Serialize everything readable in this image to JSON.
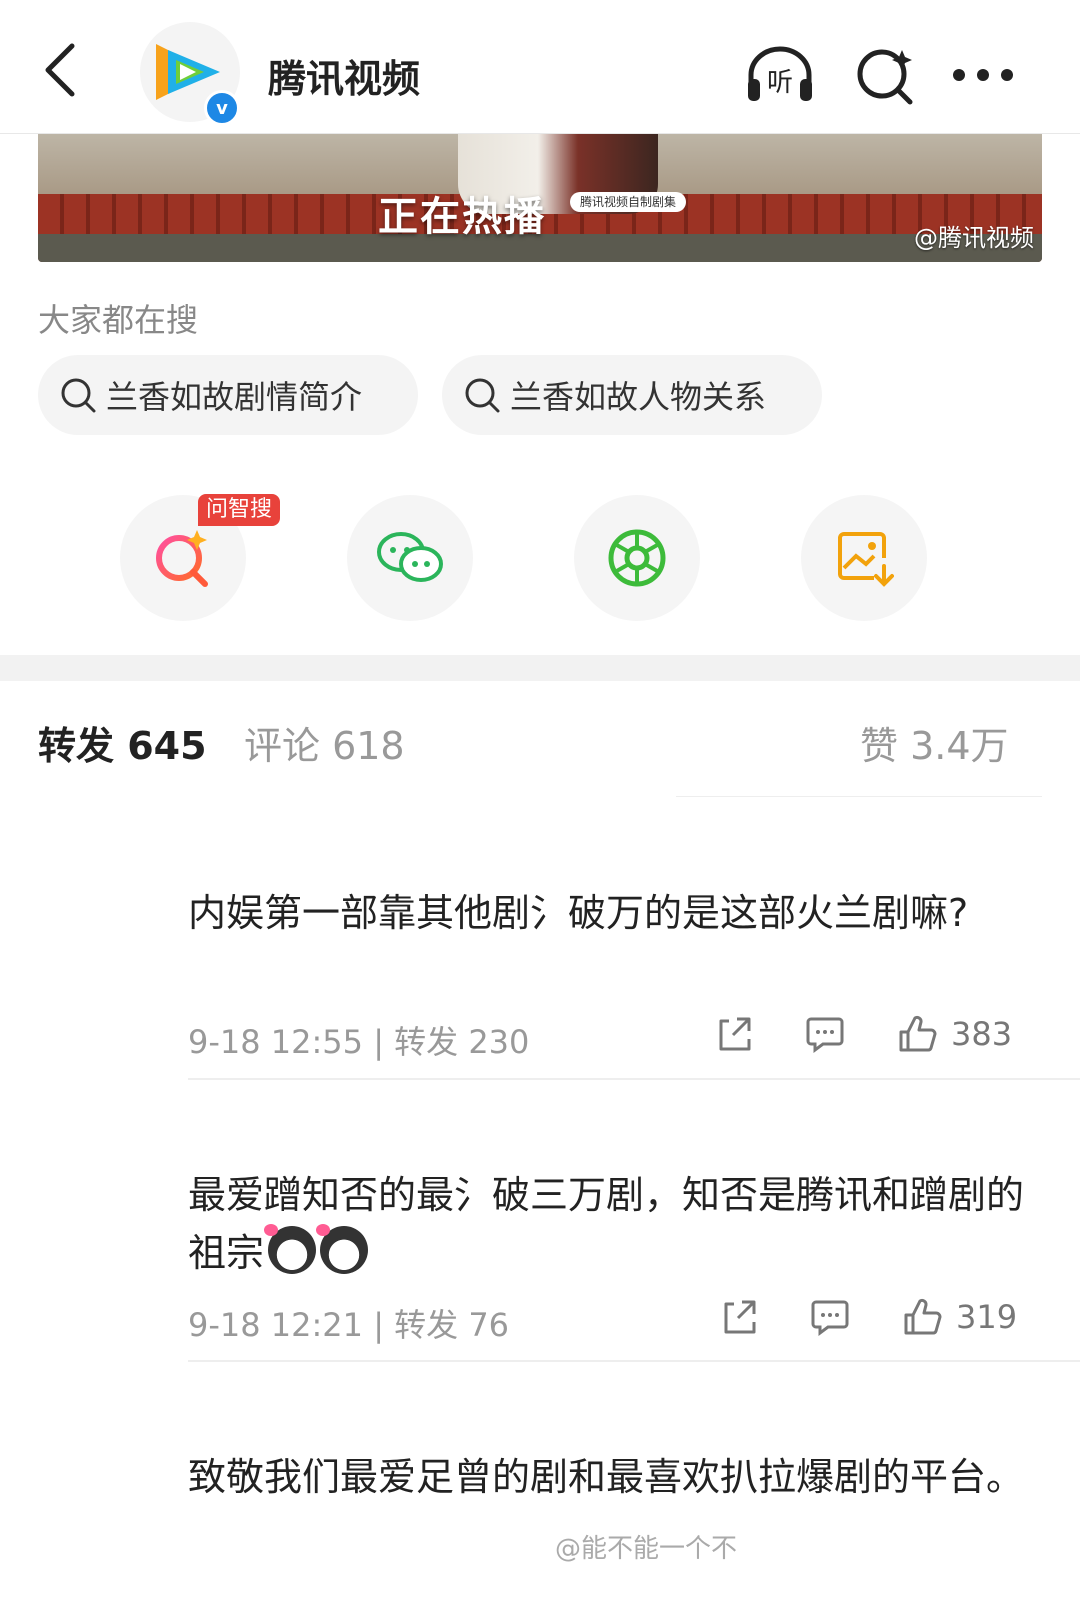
{
  "header": {
    "title": "腾讯视频",
    "back_icon": "chevron-left-icon",
    "listen_icon": "headphones-icon",
    "search_icon": "search-icon",
    "more_icon": "more-icon",
    "listen_label": "听"
  },
  "banner": {
    "headline": "正在热播",
    "tag": "腾讯视频自制剧集",
    "watermark": "@腾讯视频"
  },
  "search_section": {
    "label": "大家都在搜",
    "chips": [
      "兰香如故剧情简介",
      "兰香如故人物关系"
    ]
  },
  "share_actions": {
    "badge": "问智搜",
    "items": [
      "ai-search-icon",
      "wechat-icon",
      "moments-icon",
      "save-image-icon"
    ]
  },
  "tabs": {
    "repost": "转发 645",
    "comment": "评论 618",
    "like": "赞 3.4万"
  },
  "comments": [
    {
      "text": "内娱第一部靠其他剧氵破万的是这部火兰剧嘛?",
      "meta": "9-18 12:55 | 转发 230",
      "likes": "383"
    },
    {
      "text": "最爱蹭知否的最氵破三万剧，知否是腾讯和蹭剧的祖宗",
      "meta": "9-18 12:21 | 转发 76",
      "likes": "319"
    },
    {
      "text": "致敬我们最爱足曾的剧和最喜欢扒拉爆剧的平台。"
    }
  ],
  "watermark_bottom": "@能不能一个不"
}
